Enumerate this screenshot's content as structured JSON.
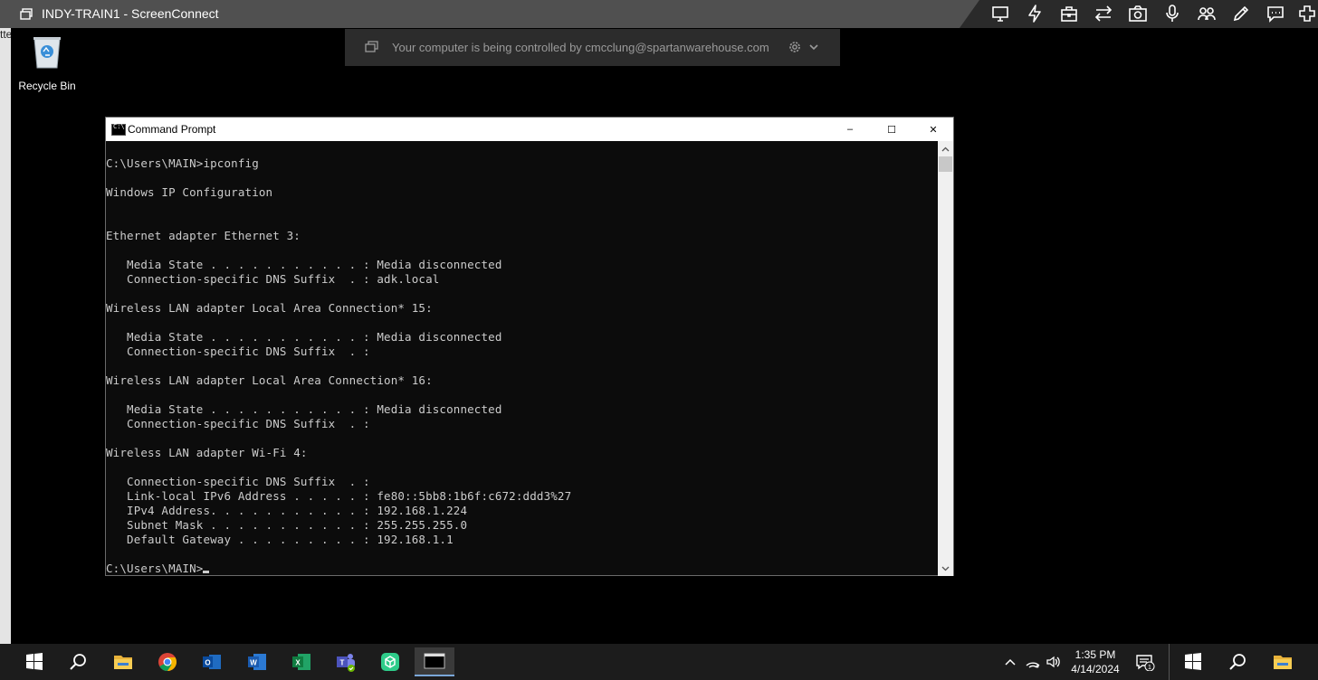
{
  "host_window": {
    "title": "INDY-TRAIN1 - ScreenConnect",
    "left_strip_text": "tte"
  },
  "toolbar": {
    "icons": [
      "monitor-icon",
      "lightning-icon",
      "toolbox-icon",
      "transfer-arrows-icon",
      "camera-icon",
      "microphone-icon",
      "participants-icon",
      "pen-icon",
      "chat-icon",
      "add-icon"
    ]
  },
  "banner": {
    "text": "Your computer is being controlled by cmcclung@spartanwarehouse.com"
  },
  "desktop": {
    "recycle_bin_label": "Recycle Bin"
  },
  "cmd": {
    "title": "Command Prompt",
    "minimize": "–",
    "maximize": "☐",
    "close": "✕",
    "lines": [
      "C:\\Users\\MAIN>ipconfig",
      "",
      "Windows IP Configuration",
      "",
      "",
      "Ethernet adapter Ethernet 3:",
      "",
      "   Media State . . . . . . . . . . . : Media disconnected",
      "   Connection-specific DNS Suffix  . : adk.local",
      "",
      "Wireless LAN adapter Local Area Connection* 15:",
      "",
      "   Media State . . . . . . . . . . . : Media disconnected",
      "   Connection-specific DNS Suffix  . :",
      "",
      "Wireless LAN adapter Local Area Connection* 16:",
      "",
      "   Media State . . . . . . . . . . . : Media disconnected",
      "   Connection-specific DNS Suffix  . :",
      "",
      "Wireless LAN adapter Wi-Fi 4:",
      "",
      "   Connection-specific DNS Suffix  . :",
      "   Link-local IPv6 Address . . . . . : fe80::5bb8:1b6f:c672:ddd3%27",
      "   IPv4 Address. . . . . . . . . . . : 192.168.1.224",
      "   Subnet Mask . . . . . . . . . . . : 255.255.255.0",
      "   Default Gateway . . . . . . . . . : 192.168.1.1",
      ""
    ],
    "prompt": "C:\\Users\\MAIN>"
  },
  "taskbar": {
    "apps": [
      "windows-start-icon",
      "search-icon",
      "file-explorer-icon",
      "chrome-icon",
      "outlook-icon",
      "word-icon",
      "excel-icon",
      "teams-icon",
      "app-cube-icon",
      "command-prompt-icon"
    ],
    "clock_time": "1:35 PM",
    "clock_date": "4/14/2024",
    "notification_count": "1"
  },
  "colors": {
    "terminal_bg": "#0c0c0c",
    "terminal_fg": "#cccccc",
    "taskbar_bg": "#1c1c1c",
    "titlebar_bg": "#505050"
  }
}
